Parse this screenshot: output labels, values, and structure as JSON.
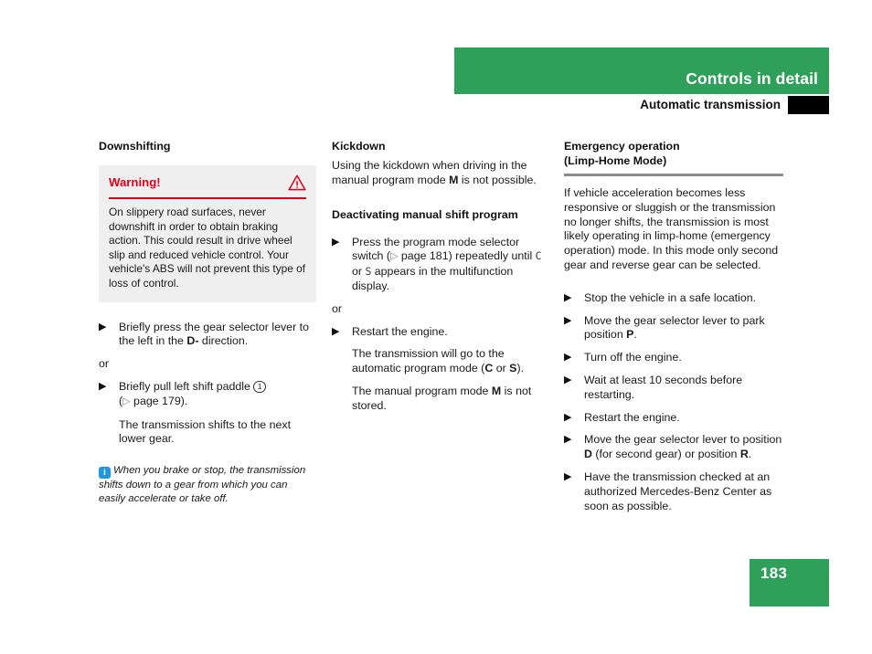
{
  "header": {
    "section_title": "Controls in detail",
    "subsection_title": "Automatic transmission"
  },
  "footer": {
    "page_number": "183"
  },
  "columns": {
    "left": {
      "heading": "Downshifting",
      "warning": {
        "label": "Warning!",
        "icon": "warning-triangle-icon",
        "text": "On slippery road surfaces, never downshift in order to obtain braking action. This could result in drive wheel slip and reduced vehicle control. Your vehicle's ABS will not prevent this type of loss of control.",
        "accent_color": "#e3001b",
        "background_color": "#efefef"
      },
      "step_1_pre": "Briefly press the gear selector lever to the left in the ",
      "step_1_bold": "D-",
      "step_1_post": " direction.",
      "or_label": "or",
      "step_2_pre": "Briefly pull left shift paddle ",
      "step_2_marker": "1",
      "step_2_ref_open": "(",
      "step_2_ref_tri": "▷",
      "step_2_ref_text": " page 179).",
      "step_2_result": "The transmission shifts to the next lower gear.",
      "note_icon": "info-icon",
      "note_text": "When you brake or stop, the transmission shifts down to a gear from which you can easily accelerate or take off."
    },
    "middle": {
      "heading_1": "Kickdown",
      "para_1_pre": "Using the kickdown when driving in the manual program mode ",
      "para_1_bold": "M",
      "para_1_post": " is not possible.",
      "heading_2": "Deactivating manual shift program",
      "step_1_a": "Press the program mode selector switch (",
      "step_1_tri": "▷",
      "step_1_b": " page 181) repeatedly until ",
      "step_1_glyph_1": "C",
      "step_1_c": " or ",
      "step_1_glyph_2": "S",
      "step_1_d": " appears in the multifunction display.",
      "or_label": "or",
      "step_2": "Restart the engine.",
      "result_1_pre": "The transmission will go to the automatic program mode (",
      "result_1_bold_1": "C",
      "result_1_mid": " or ",
      "result_1_bold_2": "S",
      "result_1_post": ").",
      "result_2_pre": "The manual program mode ",
      "result_2_bold": "M",
      "result_2_post": " is not stored."
    },
    "right": {
      "heading_line_1": "Emergency operation",
      "heading_line_2": "(Limp-Home Mode)",
      "intro": "If vehicle acceleration becomes less responsive or sluggish or the transmission no longer shifts, the transmission is most likely operating in limp-home (emergency operation) mode. In this mode only second gear and reverse gear can be selected.",
      "step_1": "Stop the vehicle in a safe location.",
      "step_2_pre": "Move the gear selector lever to park position ",
      "step_2_bold": "P",
      "step_2_post": ".",
      "step_3": "Turn off the engine.",
      "step_4": "Wait at least 10 seconds before restarting.",
      "step_5": "Restart the engine.",
      "step_6_pre": "Move the gear selector lever to position ",
      "step_6_bold_1": "D",
      "step_6_mid": " (for second gear) or position ",
      "step_6_bold_2": "R",
      "step_6_post": ".",
      "step_7": "Have the transmission checked at an authorized Mercedes-Benz Center as soon as possible."
    }
  },
  "glyphs": {
    "bullet": "▶"
  },
  "colors": {
    "brand_green": "#2fa05a",
    "warning_red": "#e3001b",
    "info_blue": "#2196dd",
    "rule_gray": "#8c8c8c"
  }
}
